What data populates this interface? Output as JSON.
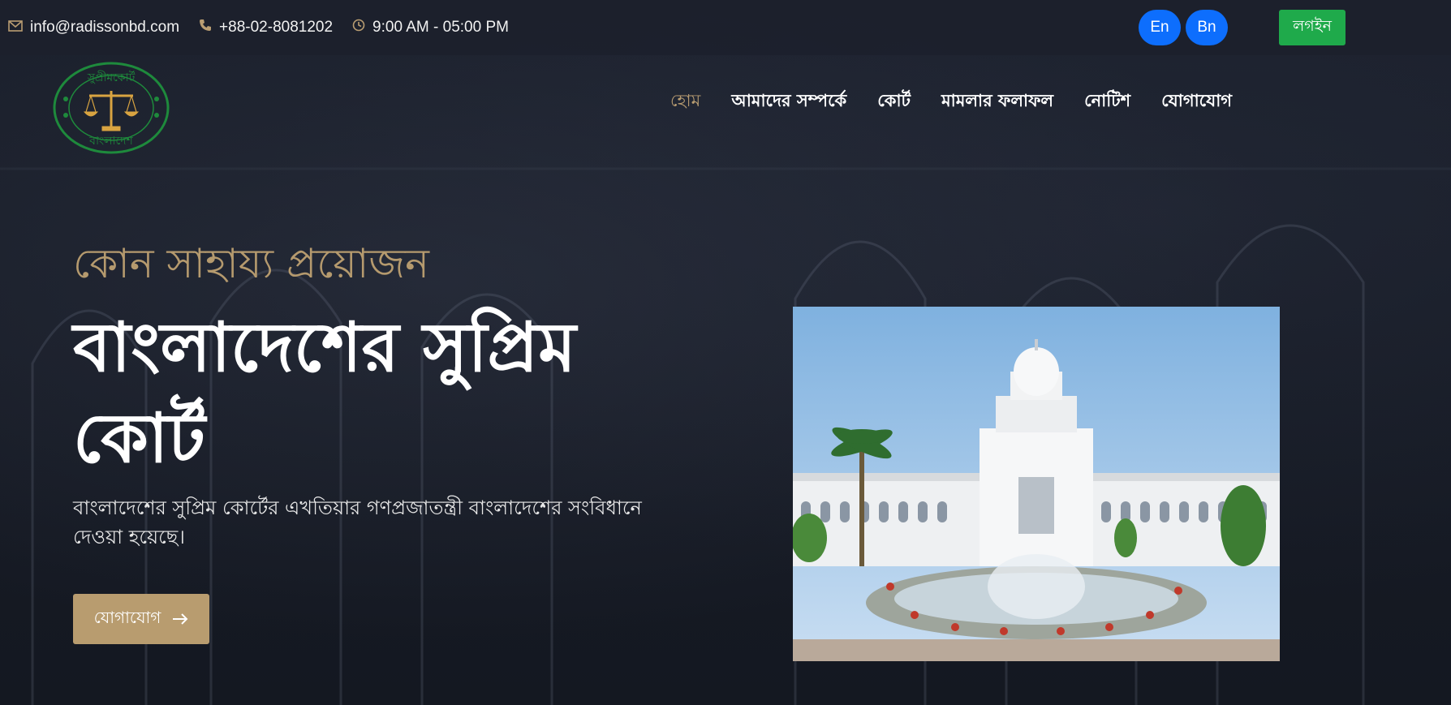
{
  "topbar": {
    "email": "info@radissonbd.com",
    "phone": "+88-02-8081202",
    "hours": "9:00 AM - 05:00 PM",
    "lang_en": "En",
    "lang_bn": "Bn",
    "login_label": "লগইন",
    "icons": [
      "envelope-icon",
      "phone-icon",
      "clock-icon"
    ]
  },
  "nav": {
    "items": [
      {
        "label": "হোম",
        "active": true
      },
      {
        "label": "আমাদের সম্পর্কে",
        "active": false
      },
      {
        "label": "কোর্ট",
        "active": false
      },
      {
        "label": "মামলার ফলাফল",
        "active": false
      },
      {
        "label": "নোটিশ",
        "active": false
      },
      {
        "label": "যোগাযোগ",
        "active": false
      }
    ]
  },
  "logo": {
    "top_text": "সুপ্রীমকোর্ট",
    "bottom_text": "বাংলাদেশ"
  },
  "hero": {
    "subtitle": "কোন সাহায্য প্রয়োজন",
    "headline": "বাংলাদেশের সুপ্রিম কোর্ট",
    "description": "বাংলাদেশের সুপ্রিম কোর্টের এখতিয়ার গণপ্রজাতন্ত্রী বাংলাদেশের সংবিধানে দেওয়া হয়েছে।",
    "cta_label": "যোগাযোগ",
    "image_alt": "Supreme Court building"
  },
  "colors": {
    "accent_gold": "#b99d72",
    "lang_blue": "#0d6efd",
    "login_green": "#1faa4b",
    "background": "#151924",
    "logo_green": "#1e8a3c"
  }
}
